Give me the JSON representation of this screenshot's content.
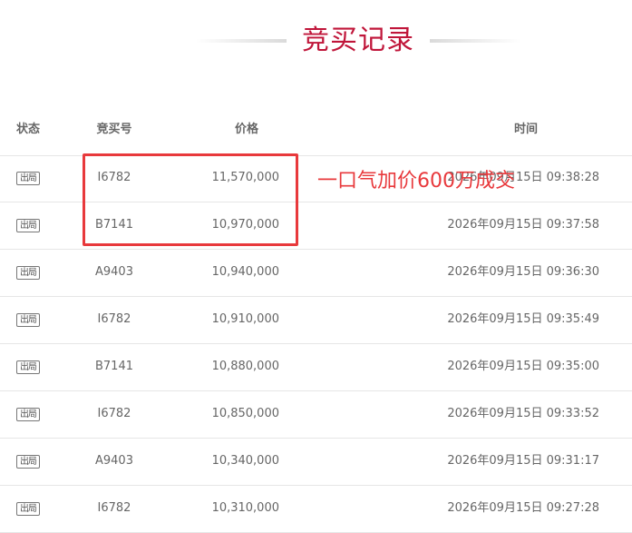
{
  "title": "竞买记录",
  "columns": {
    "status": "状态",
    "bid_no": "竞买号",
    "price": "价格",
    "time": "时间"
  },
  "rows": [
    {
      "status": "出局",
      "bid_no": "I6782",
      "price": "11,570,000",
      "time": "2026年09月15日 09:38:28"
    },
    {
      "status": "出局",
      "bid_no": "B7141",
      "price": "10,970,000",
      "time": "2026年09月15日 09:37:58"
    },
    {
      "status": "出局",
      "bid_no": "A9403",
      "price": "10,940,000",
      "time": "2026年09月15日 09:36:30"
    },
    {
      "status": "出局",
      "bid_no": "I6782",
      "price": "10,910,000",
      "time": "2026年09月15日 09:35:49"
    },
    {
      "status": "出局",
      "bid_no": "B7141",
      "price": "10,880,000",
      "time": "2026年09月15日 09:35:00"
    },
    {
      "status": "出局",
      "bid_no": "I6782",
      "price": "10,850,000",
      "time": "2026年09月15日 09:33:52"
    },
    {
      "status": "出局",
      "bid_no": "A9403",
      "price": "10,340,000",
      "time": "2026年09月15日 09:31:17"
    },
    {
      "status": "出局",
      "bid_no": "I6782",
      "price": "10,310,000",
      "time": "2026年09月15日 09:27:28"
    }
  ],
  "annotation": "一口气加价600万成交",
  "colors": {
    "title": "#c0163a",
    "annotation": "#e8393c",
    "divider": "#e6e6e6"
  }
}
